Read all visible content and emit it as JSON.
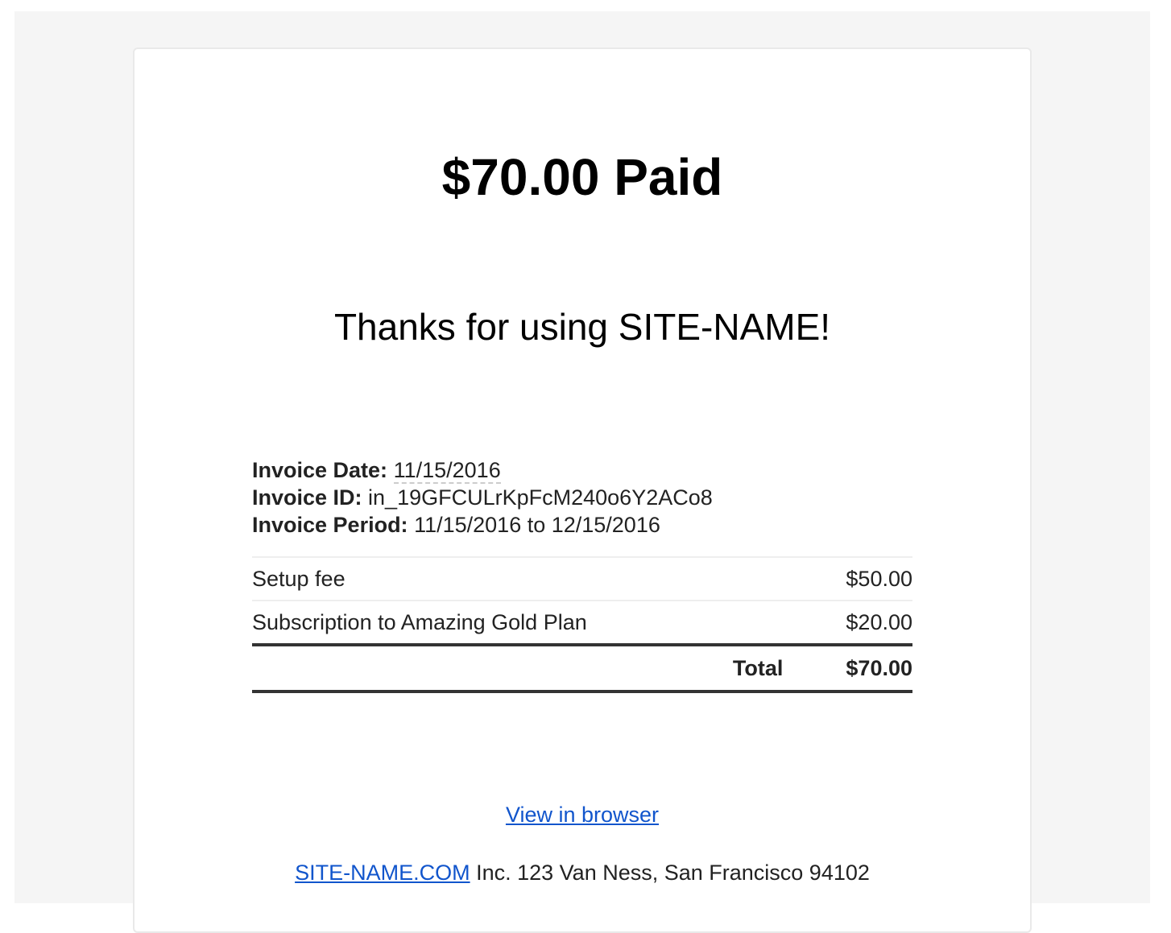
{
  "header": {
    "title": "$70.00 Paid",
    "thanks": "Thanks for using SITE-NAME!"
  },
  "invoice": {
    "date_label": "Invoice Date:",
    "date": "11/15/2016",
    "id_label": "Invoice ID:",
    "id": "in_19GFCULrKpFcM240o6Y2ACo8",
    "period_label": "Invoice Period:",
    "period": "11/15/2016 to 12/15/2016"
  },
  "items": [
    {
      "description": "Setup fee",
      "amount": "$50.00"
    },
    {
      "description": "Subscription to Amazing Gold Plan",
      "amount": "$20.00"
    }
  ],
  "total": {
    "label": "Total",
    "amount": "$70.00"
  },
  "footer": {
    "view_link": "View in browser",
    "site_link": "SITE-NAME.COM",
    "address": " Inc. 123 Van Ness, San Francisco 94102"
  },
  "colors": {
    "link": "#1155cc",
    "background": "#f5f5f5"
  }
}
